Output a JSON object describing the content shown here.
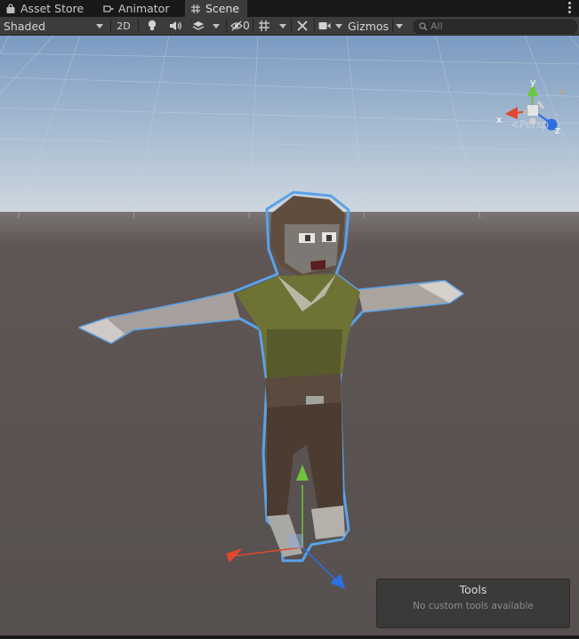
{
  "tabs": [
    {
      "label": "Asset Store",
      "icon": "shopping-bag-icon"
    },
    {
      "label": "Animator",
      "icon": "animator-icon"
    },
    {
      "label": "Scene",
      "icon": "scene-grid-icon",
      "active": true
    }
  ],
  "toolbar": {
    "shading_mode": "Shaded",
    "two_d_label": "2D",
    "hidden_count": "0",
    "gizmos_label": "Gizmos",
    "search_placeholder": "All"
  },
  "viewport": {
    "projection_label": "Persp",
    "axis_labels": {
      "x": "x",
      "y": "y",
      "z": "z"
    }
  },
  "overlay": {
    "title": "Tools",
    "message": "No custom tools available"
  },
  "colors": {
    "sky_top": "#7e9cc4",
    "horizon": "#cfd6dc",
    "ground": "#5a5150",
    "selection_outline": "#5aa2e8",
    "axis_x": "#e2472e",
    "axis_y": "#6ec43b",
    "axis_z": "#2e6fe0"
  }
}
